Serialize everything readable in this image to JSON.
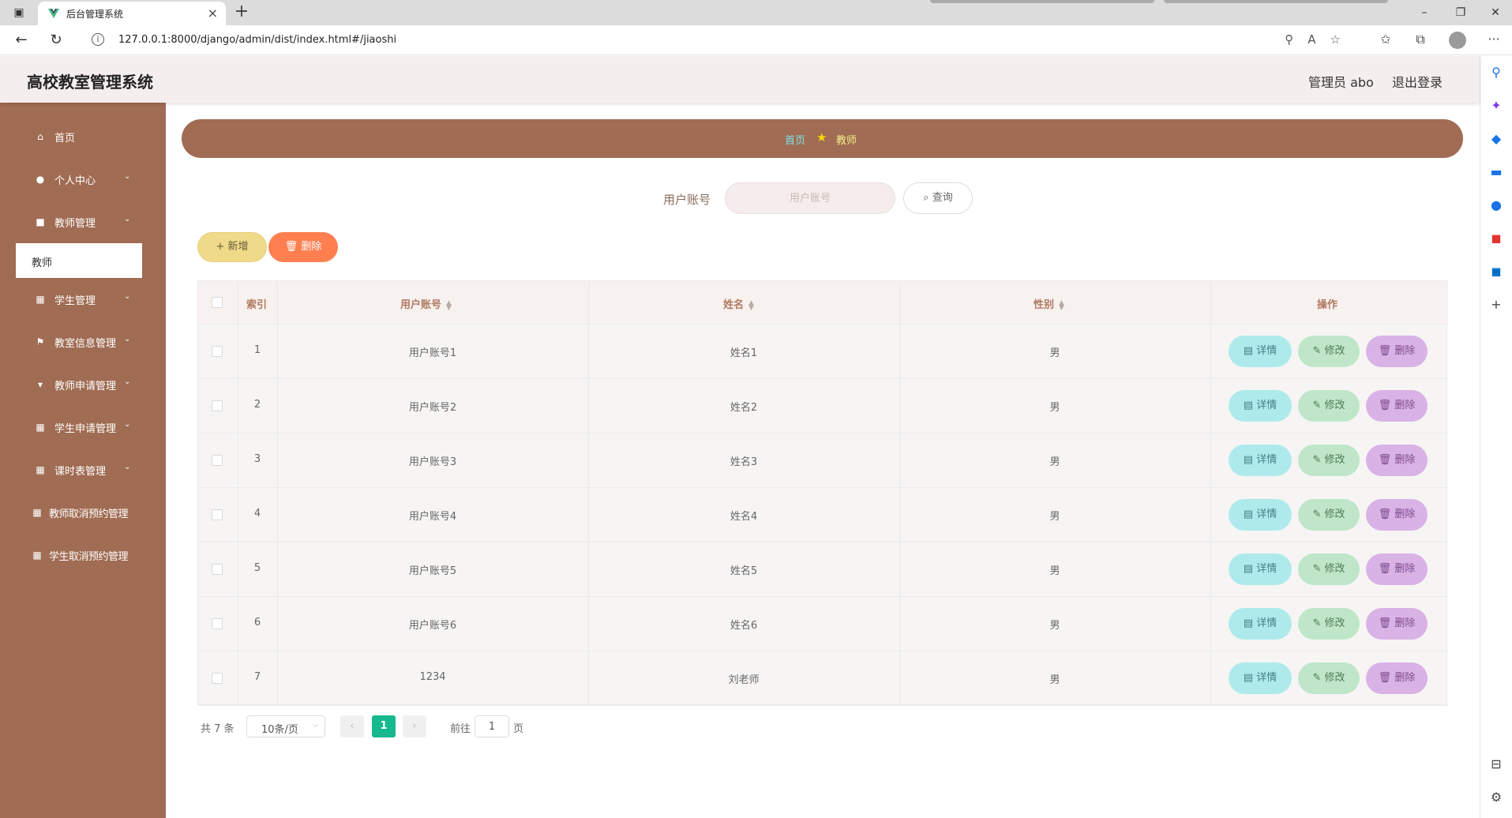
{
  "browser": {
    "tab_title": "后台管理系统",
    "tab_close": "×",
    "new_tab": "+",
    "url": "127.0.0.1:8000/django/admin/dist/index.html#/jiaoshi",
    "more": "···"
  },
  "header": {
    "title": "高校教室管理系统",
    "user": "管理员 abo",
    "logout": "退出登录"
  },
  "sidebar": {
    "items": [
      {
        "label": "首页",
        "icon": "home-icon",
        "glyph": "⌂",
        "arrow": ""
      },
      {
        "label": "个人中心",
        "icon": "user-icon",
        "glyph": "●",
        "arrow": "⌄"
      },
      {
        "label": "教师管理",
        "icon": "briefcase-icon",
        "glyph": "■",
        "arrow": "⌄"
      },
      {
        "label": "学生管理",
        "icon": "grid-icon",
        "glyph": "▦",
        "arrow": "⌄"
      },
      {
        "label": "教室信息管理",
        "icon": "flag-icon",
        "glyph": "⚑",
        "arrow": "⌄"
      },
      {
        "label": "教师申请管理",
        "icon": "pin-icon",
        "glyph": "▾",
        "arrow": "⌄"
      },
      {
        "label": "学生申请管理",
        "icon": "grid-icon",
        "glyph": "▦",
        "arrow": "⌄"
      },
      {
        "label": "课时表管理",
        "icon": "grid-icon",
        "glyph": "▦",
        "arrow": "⌄"
      },
      {
        "label": "教师取消预约管理",
        "icon": "grid-icon",
        "glyph": "▦",
        "arrow": ""
      },
      {
        "label": "学生取消预约管理",
        "icon": "grid-icon",
        "glyph": "▦",
        "arrow": ""
      }
    ],
    "active_sub": "教师"
  },
  "breadcrumb": {
    "home": "首页",
    "current": "教师"
  },
  "search": {
    "label": "用户账号",
    "placeholder": "用户账号",
    "button": "查询"
  },
  "actions": {
    "add": "新增",
    "delete": "删除"
  },
  "table": {
    "columns": [
      "索引",
      "用户账号",
      "姓名",
      "性别",
      "操作"
    ],
    "rows": [
      {
        "index": "1",
        "account": "用户账号1",
        "name": "姓名1",
        "gender": "男"
      },
      {
        "index": "2",
        "account": "用户账号2",
        "name": "姓名2",
        "gender": "男"
      },
      {
        "index": "3",
        "account": "用户账号3",
        "name": "姓名3",
        "gender": "男"
      },
      {
        "index": "4",
        "account": "用户账号4",
        "name": "姓名4",
        "gender": "男"
      },
      {
        "index": "5",
        "account": "用户账号5",
        "name": "姓名5",
        "gender": "男"
      },
      {
        "index": "6",
        "account": "用户账号6",
        "name": "姓名6",
        "gender": "男"
      },
      {
        "index": "7",
        "account": "1234",
        "name": "刘老师",
        "gender": "男"
      }
    ],
    "ops": {
      "detail": "详情",
      "edit": "修改",
      "delete": "删除"
    }
  },
  "pagination": {
    "total": "共 7 条",
    "page_size": "10条/页",
    "current": "1",
    "goto_label": "前往",
    "goto_value": "1",
    "page_suffix": "页"
  },
  "colors": {
    "sidebar": "#a06c53",
    "header": "#f5eeee",
    "add_button": "#efda89",
    "delete_button": "#ff7f50",
    "detail_button": "#aeeaec",
    "edit_button": "#bfe6c8",
    "op_delete_button": "#d9b2e6",
    "pagination_active": "#16b98e"
  }
}
